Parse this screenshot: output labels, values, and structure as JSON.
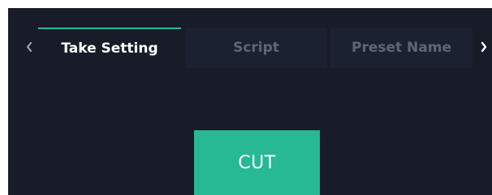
{
  "tabs": [
    {
      "label": "Take Setting",
      "active": true
    },
    {
      "label": "Script",
      "active": false
    },
    {
      "label": "Preset Name",
      "active": false
    }
  ],
  "nav": {
    "prev_icon": "chevron-left-icon",
    "next_icon": "chevron-right-icon"
  },
  "main": {
    "cut_label": "CUT"
  },
  "colors": {
    "background": "#171c28",
    "inactive_tab": "#1b2130",
    "accent": "#26b994",
    "active_text": "#ffffff",
    "inactive_text": "#5d6678"
  }
}
